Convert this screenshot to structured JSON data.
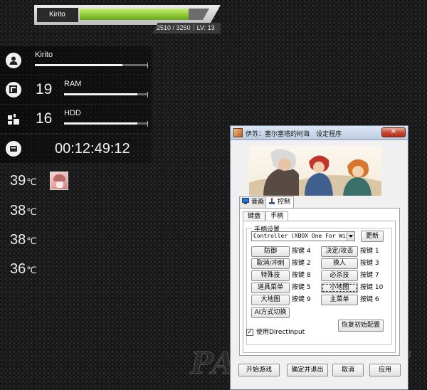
{
  "hp": {
    "name": "Kirito",
    "current": "2510",
    "max": "3250",
    "level": "LV: 13",
    "fill_fraction": 0.84
  },
  "hud": {
    "profile": {
      "name": "Kirito",
      "icon": "user-icon",
      "fill_fraction": 0.78
    },
    "ram": {
      "value": "19",
      "label": "RAM",
      "icon": "ram-icon",
      "fill_fraction": 0.88
    },
    "hdd": {
      "value": "16",
      "label": "HDD",
      "icon": "hdd-icon",
      "fill_fraction": 0.88
    },
    "uptime": {
      "value": "00:12:49:12",
      "icon": "clock-icon"
    }
  },
  "temps": [
    {
      "value": "39",
      "unit": "℃"
    },
    {
      "value": "38",
      "unit": "℃"
    },
    {
      "value": "38",
      "unit": "℃"
    },
    {
      "value": "36",
      "unit": "℃"
    }
  ],
  "watermark": "PAOPAOCHE",
  "dialog": {
    "title": "伊苏：塞尔塞塔的树海　设定程序",
    "close_glyph": "✕",
    "tabs": [
      {
        "label": "音画",
        "icon": "monitor-icon"
      },
      {
        "label": "控制",
        "icon": "joystick-icon"
      }
    ],
    "subtabs": [
      "键盘",
      "手柄"
    ],
    "group_label": "手柄设置",
    "controller_select": "Controller (XBOX One For Win",
    "refresh_button": "更新",
    "mappings_left": [
      {
        "action": "防御",
        "key": "按键 4"
      },
      {
        "action": "取消/冲刺",
        "key": "按键 2"
      },
      {
        "action": "特殊技",
        "key": "按键 8"
      },
      {
        "action": "道具菜单",
        "key": "按键 5"
      },
      {
        "action": "大地图",
        "key": "按键 9"
      }
    ],
    "mappings_right": [
      {
        "action": "决定/攻击",
        "key": "按键 1"
      },
      {
        "action": "换人",
        "key": "按键 3"
      },
      {
        "action": "必杀技",
        "key": "按键 7"
      },
      {
        "action": "小地图",
        "key": "按键 10"
      },
      {
        "action": "主菜单",
        "key": "按键 6"
      }
    ],
    "ai_switch_button": "AI方式切换",
    "directinput_checkbox": {
      "label": "使用DirectInput",
      "checked": "✓"
    },
    "restore_button": "恢复初始配置",
    "bottom_buttons": [
      "开始游戏",
      "确定并退出",
      "取消",
      "应用"
    ]
  }
}
